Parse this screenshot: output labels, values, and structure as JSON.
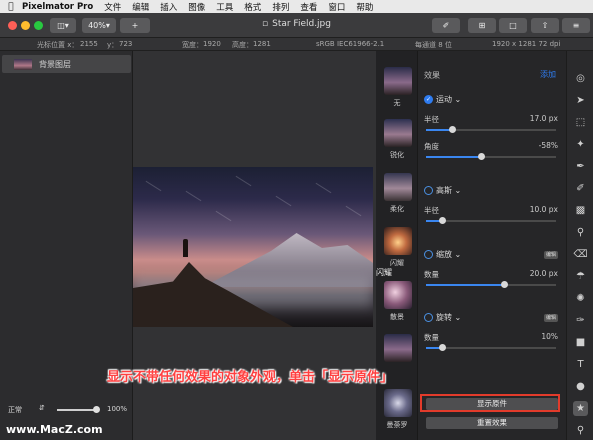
{
  "menubar": {
    "apple": "",
    "app": "Pixelmator Pro",
    "items": [
      "文件",
      "编辑",
      "插入",
      "图像",
      "工具",
      "格式",
      "排列",
      "查看",
      "窗口",
      "帮助"
    ]
  },
  "toolbar": {
    "zoom": "40%",
    "add": "+",
    "title": "Star Field.jpg"
  },
  "infobar": {
    "cursor_label": "光标位置 x：",
    "cursor_x": "2155",
    "cursor_y_label": "y：",
    "cursor_y": "723",
    "width_label": "宽度：",
    "width": "1920",
    "height_label": "高度：",
    "height": "1281",
    "colorspace": "sRGB IEC61966-2.1",
    "channel": "每通道 8 位",
    "dims": "1920 x 1281 72 dpi"
  },
  "layers": {
    "items": [
      {
        "name": "背景图层"
      }
    ],
    "blend": "正常",
    "opacity": "100%"
  },
  "presets": [
    {
      "label": "无"
    },
    {
      "label": "锐化"
    },
    {
      "label": "柔化"
    },
    {
      "label": "闪耀"
    },
    {
      "label": "散景"
    },
    {
      "label": "曼荼罗"
    }
  ],
  "effects": {
    "header": "效果",
    "add": "添加",
    "motion": {
      "name": "运动",
      "r_label": "半径",
      "r_value": "17.0 px",
      "r_level": 0.2,
      "a_label": "角度",
      "a_value": "-58%",
      "a_level": 0.42
    },
    "gaussian": {
      "name": "高斯",
      "r_label": "半径",
      "r_value": "10.0 px",
      "r_level": 0.12
    },
    "zoom": {
      "name": "缩放",
      "edit": "编辑",
      "amt_label": "数量",
      "amt_value": "20.0 px",
      "amt_level": 0.6
    },
    "twirl": {
      "name": "旋转",
      "edit": "编辑",
      "amt_label": "数量",
      "amt_value": "10%",
      "amt_level": 0.12
    },
    "show_original": "显示原件",
    "reset": "重置效果"
  },
  "overlay": {
    "callout": "显示不带任何效果的对象外观，单击「显示原件」",
    "watermark": "www.MacZ.com",
    "shine_tag": "闪耀"
  },
  "colors": {
    "accent": "#2f7cf0",
    "callout": "#ff4040",
    "box": "#e23b2b"
  }
}
